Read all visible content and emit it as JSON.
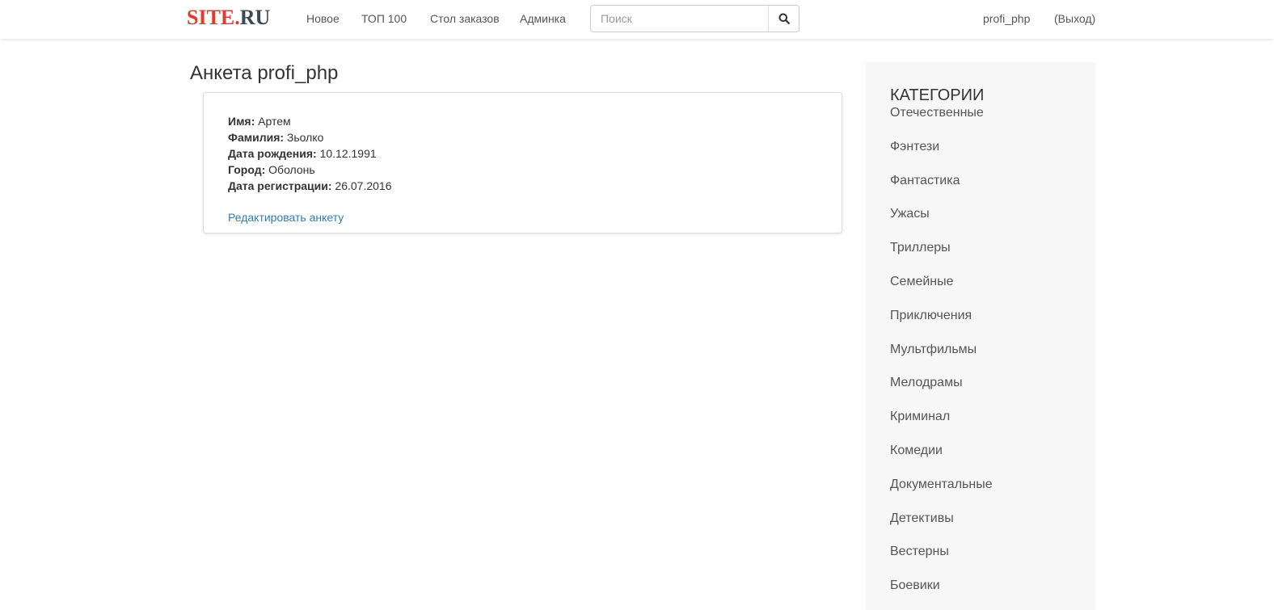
{
  "header": {
    "logo_part1": "SITE.",
    "logo_part2": "RU",
    "nav": {
      "new": "Новое",
      "top": "ТОП 100",
      "orders": "Стол заказов",
      "admin": "Админка"
    },
    "search": {
      "placeholder": "Поиск",
      "value": "",
      "icon": "search-icon"
    },
    "user": "profi_php",
    "logout": "(Выход)"
  },
  "main": {
    "title": "Анкета profi_php",
    "profile": {
      "name_label": "Имя:",
      "name_value": "Артем",
      "surname_label": "Фамилия:",
      "surname_value": "Зьолко",
      "birth_label": "Дата рождения:",
      "birth_value": "10.12.1991",
      "city_label": "Город:",
      "city_value": "Оболонь",
      "reg_label": "Дата регистрации:",
      "reg_value": "26.07.2016",
      "edit_link": "Редактировать анкету"
    }
  },
  "sidebar": {
    "title": "КАТЕГОРИИ",
    "categories": [
      "Отечественные",
      "Фэнтези",
      "Фантастика",
      "Ужасы",
      "Триллеры",
      "Семейные",
      "Приключения",
      "Мультфильмы",
      "Мелодрамы",
      "Криминал",
      "Комедии",
      "Документальные",
      "Детективы",
      "Вестерны",
      "Боевики"
    ]
  },
  "colors": {
    "logo_red": "#e23a2f",
    "logo_dark": "#3b4a55",
    "link_blue": "#337ab7",
    "sidebar_bg": "#f7f7f7"
  }
}
